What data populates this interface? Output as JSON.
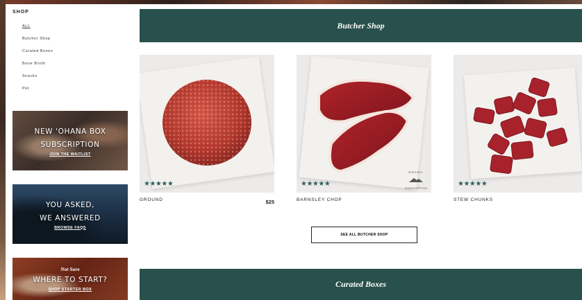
{
  "sidebar": {
    "title": "SHOP",
    "filters": [
      {
        "label": "ALL",
        "active": true
      },
      {
        "label": "Butcher Shop",
        "active": false
      },
      {
        "label": "Curated Boxes",
        "active": false
      },
      {
        "label": "Bone Broth",
        "active": false
      },
      {
        "label": "Snacks",
        "active": false
      },
      {
        "label": "Pet",
        "active": false
      }
    ],
    "promos": [
      {
        "heading_line1": "NEW 'OHANA BOX",
        "heading_line2": "SUBSCRIPTION",
        "link": "JOIN THE WAITLIST"
      },
      {
        "heading_line1": "YOU ASKED,",
        "heading_line2": "WE ANSWERED",
        "link": "BROWSE FAQS"
      },
      {
        "eyebrow": "Not Sure",
        "heading_line1": "WHERE TO START?",
        "link": "SHOP STARTER BOX"
      }
    ]
  },
  "sections": {
    "butcher_title": "Butcher Shop",
    "curated_title": "Curated Boxes"
  },
  "products": [
    {
      "name": "GROUND",
      "price": "$25",
      "rating": 5,
      "stars": "★★★★★"
    },
    {
      "name": "BARNSLEY CHOP",
      "price": "",
      "rating": 5,
      "stars": "★★★★★",
      "badge_top": "OHANA",
      "badge_bottom": "SUBSCRIPTION"
    },
    {
      "name": "STEW CHUNKS",
      "price": "$",
      "rating": 5,
      "stars": "★★★★★"
    }
  ],
  "see_all_label": "SEE ALL BUTCHER SHOP",
  "colors": {
    "banner": "#28504c",
    "stars": "#2f5e5a"
  }
}
